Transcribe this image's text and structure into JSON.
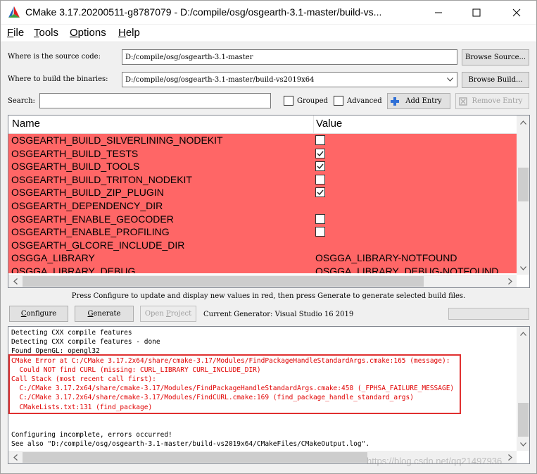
{
  "window": {
    "title": "CMake 3.17.20200511-g8787079 - D:/compile/osg/osgearth-3.1-master/build-vs...",
    "controls": {
      "minimize": "—",
      "maximize": "☐",
      "close": "✕"
    }
  },
  "menu": [
    {
      "key": "F",
      "rest": "ile"
    },
    {
      "key": "T",
      "rest": "ools"
    },
    {
      "key": "O",
      "rest": "ptions"
    },
    {
      "key": "H",
      "rest": "elp"
    }
  ],
  "source": {
    "label": "Where is the source code:",
    "value": "D:/compile/osg/osgearth-3.1-master",
    "browse_button": "Browse Source..."
  },
  "build": {
    "label": "Where to build the binaries:",
    "value": "D:/compile/osg/osgearth-3.1-master/build-vs2019x64",
    "browse_button": "Browse Build..."
  },
  "search": {
    "label": "Search:",
    "value": "",
    "grouped_label": "Grouped",
    "advanced_label": "Advanced",
    "add_entry_label": "Add Entry",
    "remove_entry_label": "Remove Entry"
  },
  "table": {
    "headers": {
      "name": "Name",
      "value": "Value"
    },
    "rows": [
      {
        "name": "OSGEARTH_BUILD_SILVERLINING_NODEKIT",
        "type": "bool",
        "checked": false
      },
      {
        "name": "OSGEARTH_BUILD_TESTS",
        "type": "bool",
        "checked": true
      },
      {
        "name": "OSGEARTH_BUILD_TOOLS",
        "type": "bool",
        "checked": true
      },
      {
        "name": "OSGEARTH_BUILD_TRITON_NODEKIT",
        "type": "bool",
        "checked": false
      },
      {
        "name": "OSGEARTH_BUILD_ZIP_PLUGIN",
        "type": "bool",
        "checked": true
      },
      {
        "name": "OSGEARTH_DEPENDENCY_DIR",
        "type": "text",
        "value": ""
      },
      {
        "name": "OSGEARTH_ENABLE_GEOCODER",
        "type": "bool",
        "checked": false
      },
      {
        "name": "OSGEARTH_ENABLE_PROFILING",
        "type": "bool",
        "checked": false
      },
      {
        "name": "OSGEARTH_GLCORE_INCLUDE_DIR",
        "type": "text",
        "value": ""
      },
      {
        "name": "OSGGA_LIBRARY",
        "type": "text",
        "value": "OSGGA_LIBRARY-NOTFOUND"
      },
      {
        "name": "OSGGA_LIBRARY_DEBUG",
        "type": "text",
        "value": "OSGGA_LIBRARY_DEBUG-NOTFOUND"
      }
    ],
    "row_color": "#ff6666"
  },
  "hint": "Press Configure to update and display new values in red, then press Generate to generate selected build files.",
  "actions": {
    "configure_key": "C",
    "configure_rest": "onfigure",
    "generate_key": "G",
    "generate_rest": "enerate",
    "open_project_pre": "Open ",
    "open_project_key": "P",
    "open_project_rest": "roject",
    "generator_text": "Current Generator: Visual Studio 16 2019"
  },
  "log": [
    {
      "text": "Detecting CXX compile features",
      "error": false
    },
    {
      "text": "Detecting CXX compile features - done",
      "error": false
    },
    {
      "text": "Found OpenGL: opengl32",
      "error": false
    },
    {
      "text": "CMake Error at C:/CMake 3.17.2x64/share/cmake-3.17/Modules/FindPackageHandleStandardArgs.cmake:165 (message):",
      "error": true
    },
    {
      "text": "  Could NOT find CURL (missing: CURL_LIBRARY CURL_INCLUDE_DIR)",
      "error": true
    },
    {
      "text": "Call Stack (most recent call first):",
      "error": true
    },
    {
      "text": "  C:/CMake 3.17.2x64/share/cmake-3.17/Modules/FindPackageHandleStandardArgs.cmake:458 (_FPHSA_FAILURE_MESSAGE)",
      "error": true
    },
    {
      "text": "  C:/CMake 3.17.2x64/share/cmake-3.17/Modules/FindCURL.cmake:169 (find_package_handle_standard_args)",
      "error": true
    },
    {
      "text": "  CMakeLists.txt:131 (find_package)",
      "error": true
    },
    {
      "text": "",
      "error": false
    },
    {
      "text": "",
      "error": false
    },
    {
      "text": "Configuring incomplete, errors occurred!",
      "error": false
    },
    {
      "text": "See also \"D:/compile/osg/osgearth-3.1-master/build-vs2019x64/CMakeFiles/CMakeOutput.log\".",
      "error": false
    }
  ],
  "watermark": "https://blog.csdn.net/qq21497936"
}
